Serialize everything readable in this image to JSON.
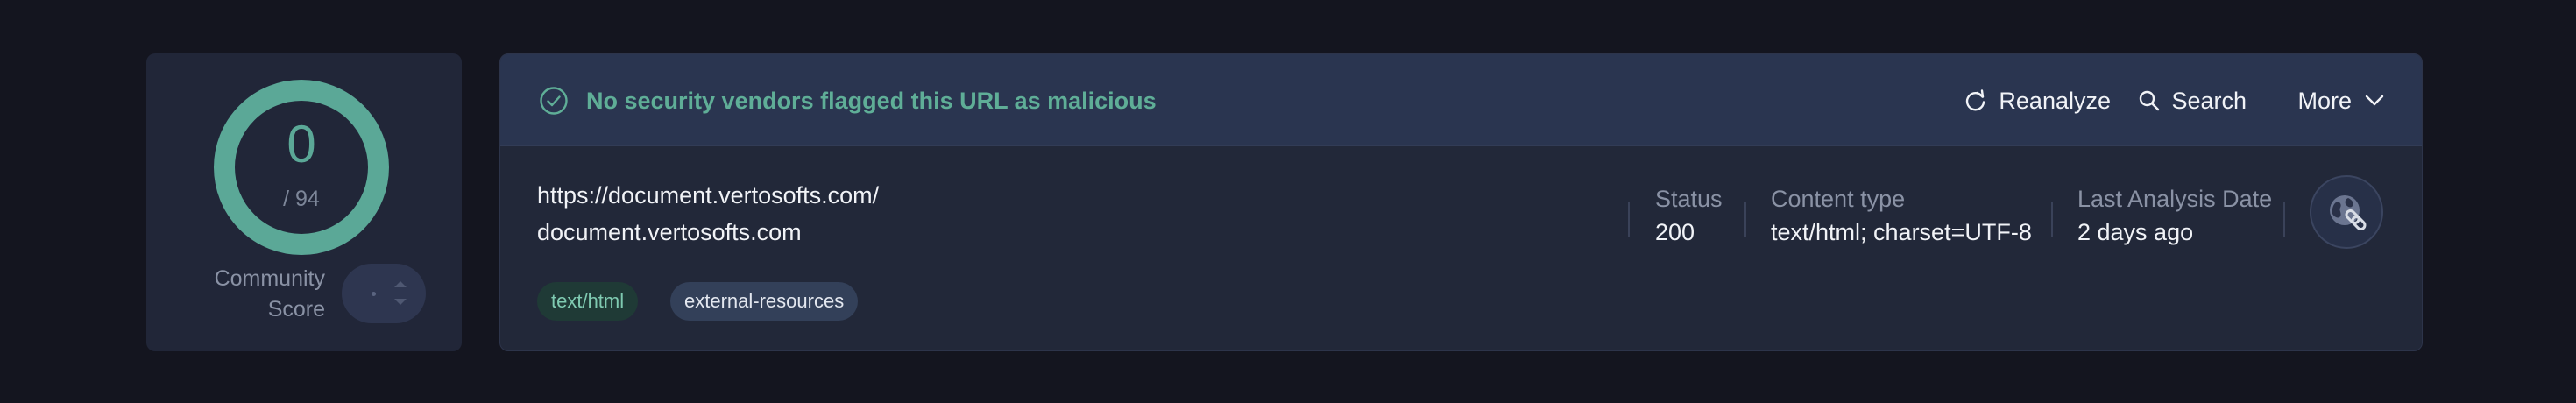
{
  "score": {
    "value": "0",
    "total": "/ 94",
    "community_label_line1": "Community",
    "community_label_line2": "Score"
  },
  "banner": {
    "message": "No security vendors flagged this URL as malicious",
    "status_color": "#5fae97"
  },
  "actions": {
    "reanalyze": "Reanalyze",
    "search": "Search",
    "more": "More"
  },
  "url": {
    "full": "https://document.vertosofts.com/",
    "domain": "document.vertosofts.com"
  },
  "tags": [
    "text/html",
    "external-resources"
  ],
  "meta": {
    "status_label": "Status",
    "status_value": "200",
    "content_type_label": "Content type",
    "content_type_value": "text/html; charset=UTF-8",
    "last_analysis_label": "Last Analysis Date",
    "last_analysis_value": "2 days ago"
  },
  "icons": {
    "banner": "check-circle-icon",
    "reanalyze": "refresh-icon",
    "search": "search-icon",
    "more": "chevron-down-icon",
    "url_type": "globe-link-icon"
  }
}
